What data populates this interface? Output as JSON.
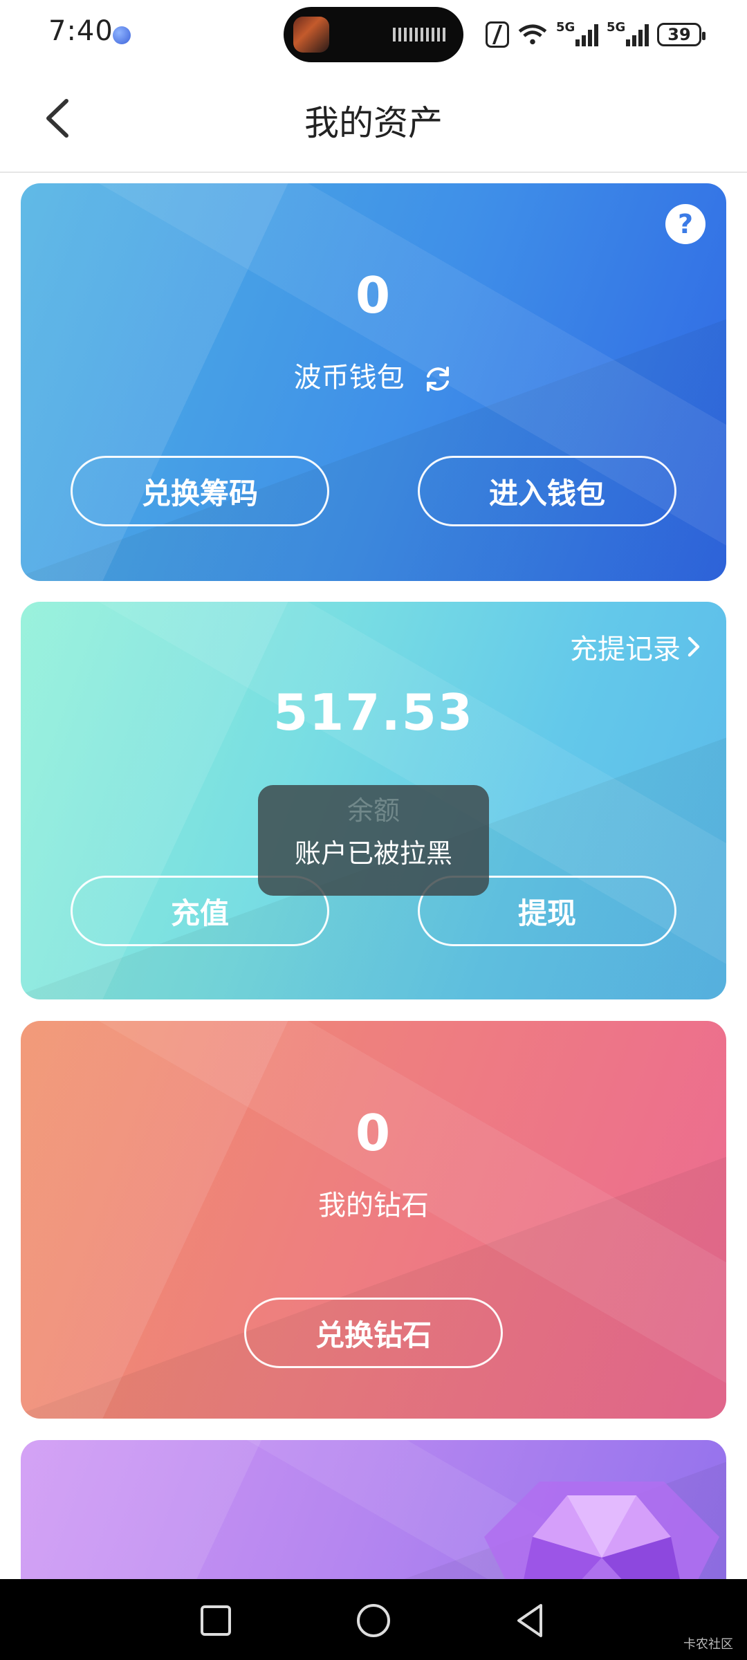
{
  "status_bar": {
    "time": "7:40",
    "battery": "39",
    "signal1": "5G",
    "signal2": "5G"
  },
  "header": {
    "title": "我的资产",
    "back_icon": "chevron-left-icon"
  },
  "wallet_card": {
    "value": "0",
    "label": "波币钱包",
    "buttons": [
      "兑换筹码",
      "进入钱包"
    ],
    "help_text": "?"
  },
  "balance_card": {
    "link": "充提记录",
    "value": "517.53",
    "label": "余额",
    "buttons": [
      "充值",
      "提现"
    ]
  },
  "diamond_card": {
    "value": "0",
    "label": "我的钻石",
    "button": "兑换钻石"
  },
  "toast": {
    "message": "账户已被拉黑"
  },
  "watermark": "卡农社区",
  "colors": {
    "wallet_gradient": [
      "#4fb2e3",
      "#2f67e4"
    ],
    "balance_gradient": [
      "#8ff0d8",
      "#5ab8e9"
    ],
    "diamond_gradient": [
      "#f0906a",
      "#ec6a92"
    ],
    "purple_gradient": [
      "#cf98f4",
      "#9170ec"
    ]
  }
}
